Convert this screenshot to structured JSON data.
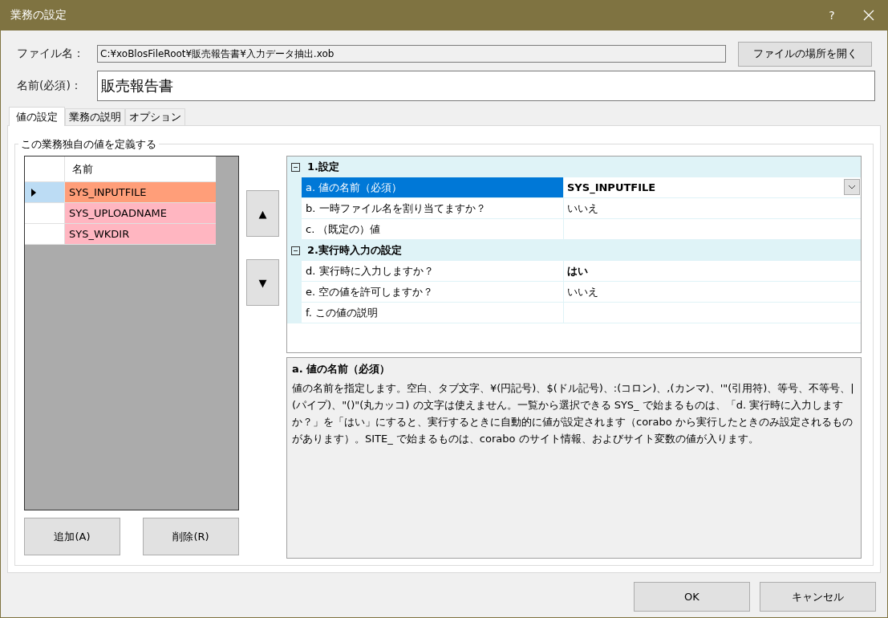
{
  "window": {
    "title": "業務の設定",
    "help_button": "?"
  },
  "file": {
    "label": "ファイル名：",
    "value": "C:¥xoBlosFileRoot¥販売報告書¥入力データ抽出.xob",
    "open_button": "ファイルの場所を開く"
  },
  "name": {
    "label": "名前(必須)：",
    "value": "販売報告書"
  },
  "tabs": [
    {
      "label": "値の設定",
      "selected": true
    },
    {
      "label": "業務の説明",
      "selected": false
    },
    {
      "label": "オプション",
      "selected": false
    }
  ],
  "group": {
    "title": "この業務独自の値を定義する"
  },
  "variables": {
    "column": "名前",
    "rows": [
      {
        "name": "SYS_INPUTFILE",
        "selected": true,
        "color": "#ff9e79"
      },
      {
        "name": "SYS_UPLOADNAME",
        "selected": false,
        "color": "#ffb6c1"
      },
      {
        "name": "SYS_WKDIR",
        "selected": false,
        "color": "#ffb6c1"
      }
    ]
  },
  "move_buttons": {
    "up": "▲",
    "down": "▼"
  },
  "property_grid": {
    "categories": [
      {
        "title": "1.設定",
        "expanded": true,
        "properties": [
          {
            "label": "a. 値の名前（必須）",
            "value": "SYS_INPUTFILE",
            "selected": true,
            "bold": true
          },
          {
            "label": "b. 一時ファイル名を割り当てますか？",
            "value": "いいえ",
            "selected": false,
            "bold": false
          },
          {
            "label": "c. （既定の）値",
            "selected": false
          }
        ]
      },
      {
        "title": "2.実行時入力の設定",
        "expanded": true,
        "properties": [
          {
            "label": "d. 実行時に入力しますか？",
            "value": "はい",
            "selected": false,
            "bold": true
          },
          {
            "label": "e. 空の値を許可しますか？",
            "value": "いいえ",
            "selected": false,
            "bold": false
          },
          {
            "label": "f. この値の説明",
            "selected": false
          }
        ]
      }
    ]
  },
  "help": {
    "title": "a. 値の名前（必須）",
    "text": "値の名前を指定します。空白、タブ文字、¥(円記号)、$(ドル記号)、:(コロン)、,(カンマ)、'\"(引用符)、等号、不等号、|(パイプ)、\"()\"(丸カッコ) の文字は使えません。一覧から選択できる SYS_ で始まるものは、「d. 実行時に入力しますか？」を「はい」にすると、実行するときに自動的に値が設定されます（corabo から実行したときのみ設定されるものがあります）。SITE_ で始まるものは、corabo のサイト情報、およびサイト変数の値が入ります。"
  },
  "list_buttons": {
    "add": "追加(A)",
    "remove": "削除(R)"
  },
  "dialog_buttons": {
    "ok": "OK",
    "cancel": "キャンセル"
  }
}
